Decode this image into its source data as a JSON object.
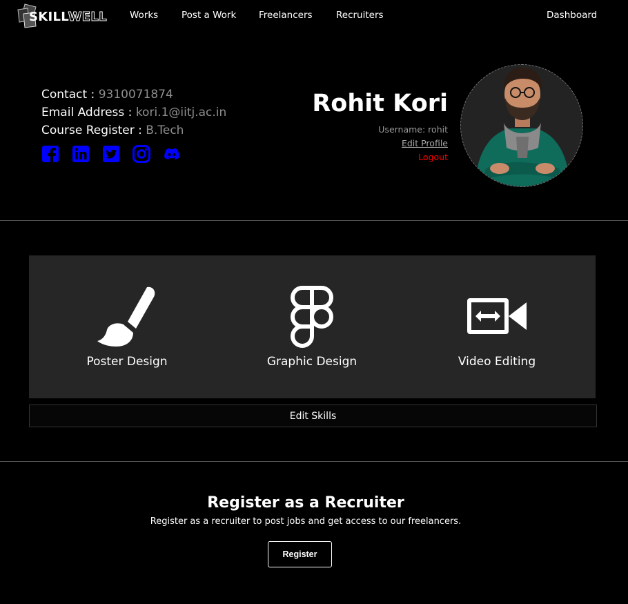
{
  "nav": {
    "logo_part1": "SKILL",
    "logo_part2": "WELL",
    "links": [
      "Works",
      "Post a Work",
      "Freelancers",
      "Recruiters"
    ],
    "dashboard": "Dashboard"
  },
  "profile": {
    "contact_label": "Contact :",
    "contact_value": "9310071874",
    "email_label": "Email Address :",
    "email_value": "kori.1@iitj.ac.in",
    "course_label": "Course Register :",
    "course_value": "B.Tech",
    "name": "Rohit Kori",
    "username": "Username: rohit",
    "edit_profile": "Edit Profile",
    "logout": "Logout",
    "socials": [
      "facebook-icon",
      "linkedin-icon",
      "twitter-icon",
      "instagram-icon",
      "discord-icon"
    ],
    "social_color": "#0000ff"
  },
  "skills": {
    "items": [
      {
        "label": "Poster Design",
        "icon": "paintbrush-icon"
      },
      {
        "label": "Graphic Design",
        "icon": "figma-icon"
      },
      {
        "label": "Video Editing",
        "icon": "video-resize-icon"
      }
    ],
    "edit_label": "Edit Skills"
  },
  "recruiter": {
    "title": "Register as a Recruiter",
    "description": "Register as a recruiter to post jobs and get access to our freelancers.",
    "button": "Register"
  }
}
